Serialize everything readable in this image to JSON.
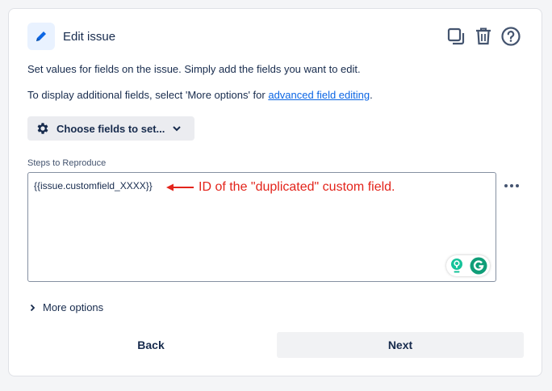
{
  "header": {
    "title": "Edit issue",
    "icon": "pencil-icon",
    "actions": [
      "duplicate-icon",
      "trash-icon",
      "help-icon"
    ]
  },
  "description": {
    "line1": "Set values for fields on the issue. Simply add the fields you want to edit.",
    "line2_prefix": "To display additional fields, select 'More options' for ",
    "line2_link": "advanced field editing",
    "line2_suffix": "."
  },
  "choose_fields": {
    "label": "Choose fields to set..."
  },
  "field": {
    "label": "Steps to Reproduce",
    "value": "{{issue.customfield_XXXX}}",
    "annotation": "ID of the \"duplicated\" custom field."
  },
  "more_options": {
    "label": "More options"
  },
  "buttons": {
    "back": "Back",
    "next": "Next"
  },
  "colors": {
    "accent": "#0c66e4",
    "annotation": "#e3241b",
    "grammarly": "#15c39a"
  }
}
